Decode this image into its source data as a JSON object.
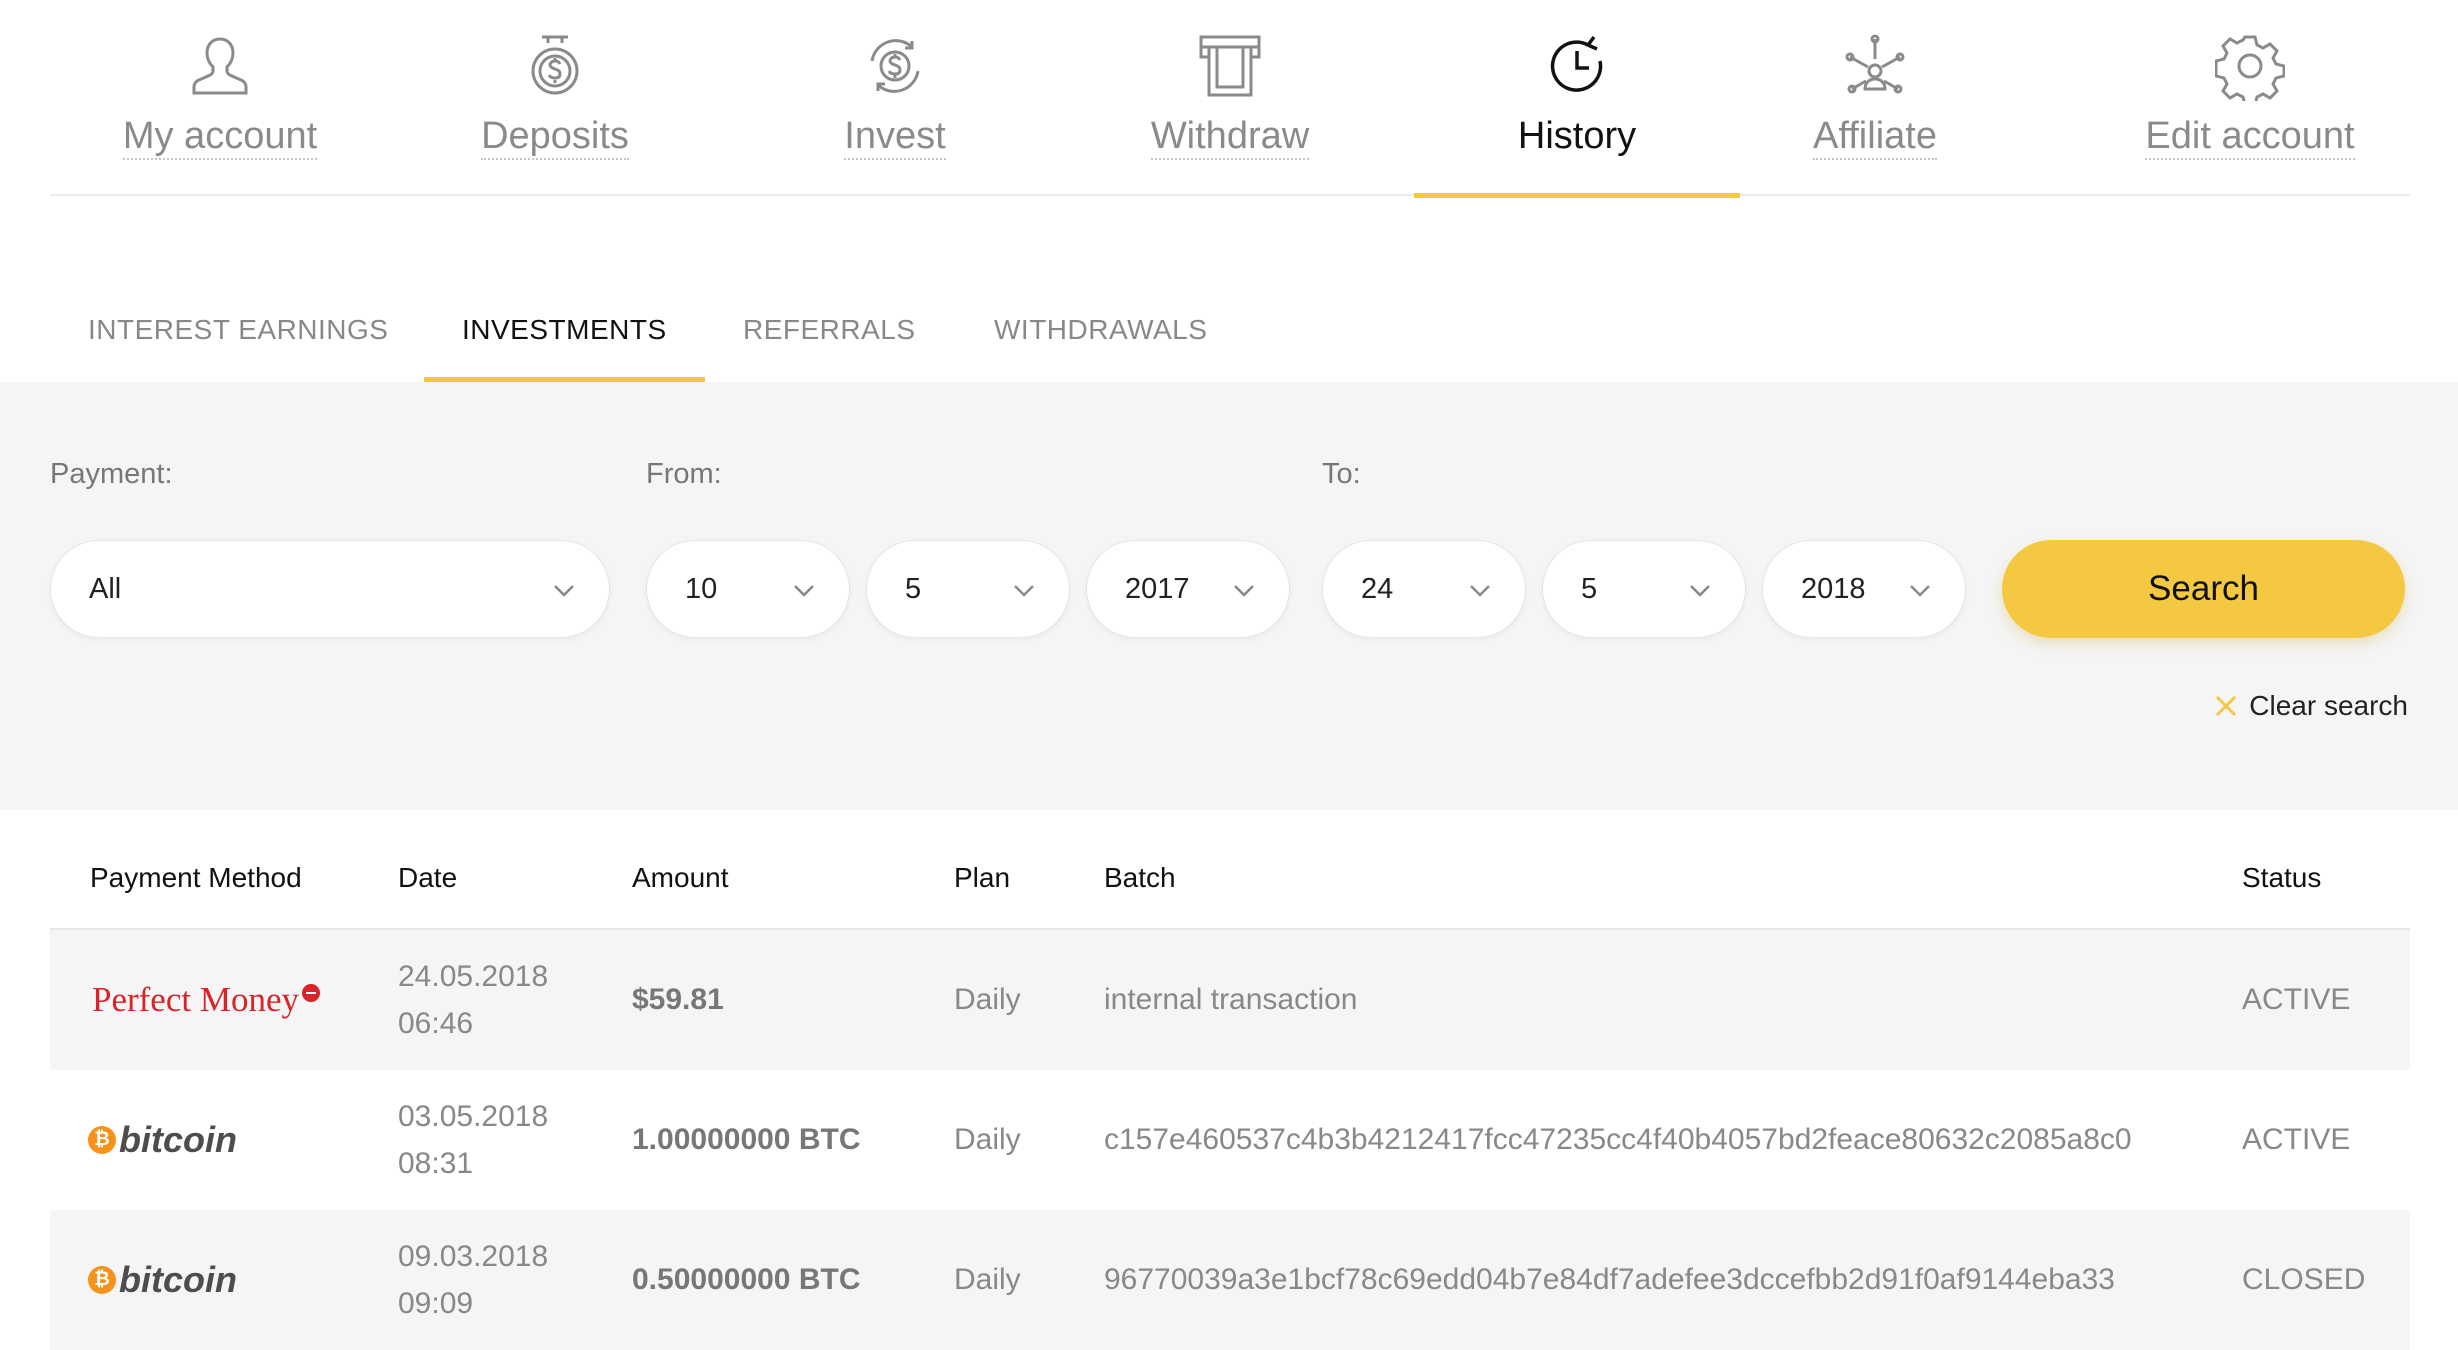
{
  "nav": {
    "items": [
      {
        "label": "My account",
        "icon": "user-icon"
      },
      {
        "label": "Deposits",
        "icon": "dollar-coin-icon"
      },
      {
        "label": "Invest",
        "icon": "invest-refresh-dollar-icon"
      },
      {
        "label": "Withdraw",
        "icon": "atm-withdraw-icon"
      },
      {
        "label": "History",
        "icon": "history-clock-icon"
      },
      {
        "label": "Affiliate",
        "icon": "affiliate-network-icon"
      },
      {
        "label": "Edit account",
        "icon": "gear-icon"
      }
    ],
    "active": "History"
  },
  "subtabs": {
    "items": [
      "INTEREST EARNINGS",
      "INVESTMENTS",
      "REFERRALS",
      "WITHDRAWALS"
    ],
    "active": "INVESTMENTS"
  },
  "filters": {
    "payment_label": "Payment:",
    "from_label": "From:",
    "to_label": "To:",
    "payment_value": "All",
    "from_day": "10",
    "from_month": "5",
    "from_year": "2017",
    "to_day": "24",
    "to_month": "5",
    "to_year": "2018",
    "search_label": "Search",
    "clear_label": "Clear search"
  },
  "table": {
    "headers": {
      "method": "Payment Method",
      "date": "Date",
      "amount": "Amount",
      "plan": "Plan",
      "batch": "Batch",
      "status": "Status"
    },
    "rows": [
      {
        "method": "Perfect Money",
        "date": "24.05.2018",
        "time": "06:46",
        "amount": "$59.81",
        "plan": "Daily",
        "batch": "internal transaction",
        "status": "ACTIVE"
      },
      {
        "method": "bitcoin",
        "date": "03.05.2018",
        "time": "08:31",
        "amount": "1.00000000 BTC",
        "plan": "Daily",
        "batch": "c157e460537c4b3b4212417fcc47235cc4f40b4057bd2feace80632c2085a8c0",
        "status": "ACTIVE"
      },
      {
        "method": "bitcoin",
        "date": "09.03.2018",
        "time": "09:09",
        "amount": "0.50000000 BTC",
        "plan": "Daily",
        "batch": "96770039a3e1bcf78c69edd04b7e84df7adefee3dccefbb2d91f0af9144eba33",
        "status": "CLOSED"
      }
    ]
  },
  "colors": {
    "accent": "#f5c842",
    "panel_bg": "#f5f5f5",
    "perfect_money_red": "#d8232a",
    "bitcoin_orange": "#f7931a"
  }
}
